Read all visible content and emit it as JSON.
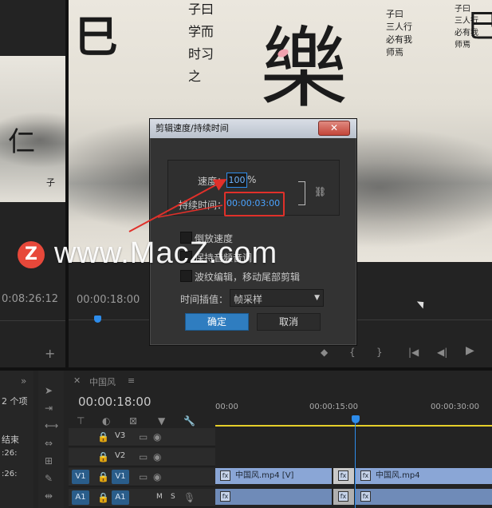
{
  "source_monitor": {
    "timecode": "0:08:26:12"
  },
  "program_monitor": {
    "timecode": "00:00:18:00",
    "calligraphy": {
      "col1": "子曰\n学而\n时习\n之",
      "col2": "子曰\n三人行\n必有我\n师焉"
    }
  },
  "dialog": {
    "title": "剪辑速度/持续时间",
    "close_glyph": "✕",
    "speed_label": "速度：",
    "speed_value": "100",
    "speed_unit": "%",
    "duration_label": "持续时间：",
    "duration_value": "00:00:03:00",
    "reverse_label": "倒放速度",
    "keep_audio_label": "保持音频音调",
    "ripple_label": "波纹编辑，移动尾部剪辑",
    "interp_label": "时间插值：",
    "interp_value": "帧采样",
    "ok_label": "确定",
    "cancel_label": "取消"
  },
  "project_panel": {
    "items_count": "2 个项",
    "col_end": "结束",
    "row1": ":26:",
    "row2": ":26:"
  },
  "sequence": {
    "tab_label": "中国风",
    "menu_glyph": "≡",
    "playhead_tc": "00:00:18:00",
    "ruler": [
      "00:00",
      "00:00:15:00",
      "00:00:30:00"
    ],
    "tracks": {
      "v3": "V3",
      "v2": "V2",
      "v1_src": "V1",
      "v1": "V1",
      "a1_src": "A1",
      "a1": "A1",
      "m": "M",
      "s": "S"
    },
    "clips": [
      {
        "label": "中国风.mp4 [V]"
      },
      {
        "label": "中国风.mp4"
      }
    ]
  },
  "watermark": {
    "logo": "Z",
    "text": "www.MacZ.com"
  },
  "colors": {
    "accent_blue": "#2d8ceb",
    "highlight_red": "#e0302a",
    "clip_blue": "#8aa6d6",
    "track_chip": "#2a5d8a",
    "ok_button": "#2f7dc0"
  }
}
